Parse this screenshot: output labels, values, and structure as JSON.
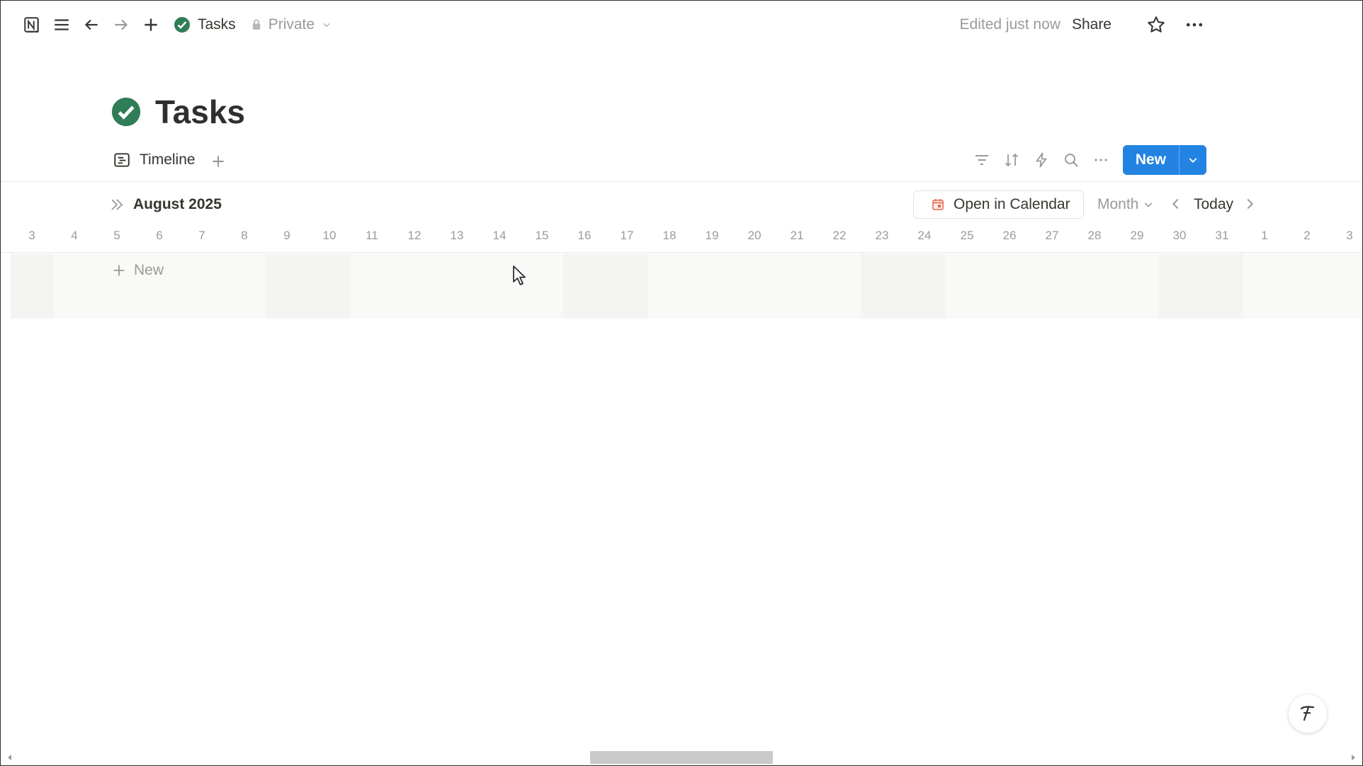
{
  "topbar": {
    "breadcrumb_title": "Tasks",
    "privacy_label": "Private",
    "edited_label": "Edited just now",
    "share_label": "Share"
  },
  "page": {
    "title": "Tasks"
  },
  "views": {
    "active_tab": "Timeline",
    "new_button_label": "New"
  },
  "timeline": {
    "month_label": "August 2025",
    "open_calendar_label": "Open in Calendar",
    "zoom_label": "Month",
    "today_label": "Today",
    "new_row_label": "New",
    "dates": [
      "3",
      "4",
      "5",
      "6",
      "7",
      "8",
      "9",
      "10",
      "11",
      "12",
      "13",
      "14",
      "15",
      "16",
      "17",
      "18",
      "19",
      "20",
      "21",
      "22",
      "23",
      "24",
      "25",
      "26",
      "27",
      "28",
      "29",
      "30",
      "31",
      "1",
      "2",
      "3"
    ]
  },
  "colors": {
    "accent": "#2383e2",
    "check_green": "#2f7d59",
    "text": "#37352f",
    "muted": "#9b9a97"
  },
  "icons": {
    "app_logo": "notion-logo-icon",
    "menu": "hamburger-icon",
    "back": "arrow-left-icon",
    "forward": "arrow-right-icon",
    "add": "plus-icon",
    "favorite": "star-icon",
    "more": "more-horizontal-icon",
    "view_tab": "timeline-icon",
    "filter": "filter-icon",
    "sort": "sort-icon",
    "automation": "lightning-icon",
    "search": "search-icon",
    "calendar": "calendar-icon",
    "help": "help-icon"
  }
}
